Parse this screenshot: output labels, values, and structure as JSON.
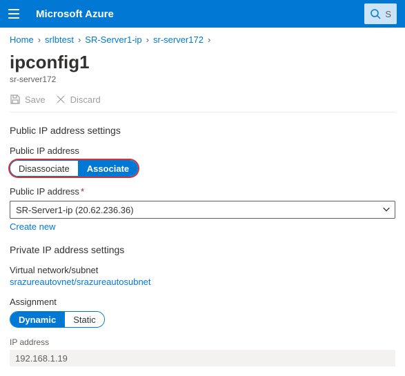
{
  "header": {
    "brand": "Microsoft Azure",
    "search_placeholder": "S"
  },
  "breadcrumb": {
    "items": [
      "Home",
      "srlbtest",
      "SR-Server1-ip",
      "sr-server172"
    ]
  },
  "page": {
    "title": "ipconfig1",
    "subtitle": "sr-server172"
  },
  "toolbar": {
    "save_label": "Save",
    "discard_label": "Discard"
  },
  "public_ip": {
    "section_title": "Public IP address settings",
    "toggle_label": "Public IP address",
    "disassociate_label": "Disassociate",
    "associate_label": "Associate",
    "select_label": "Public IP address",
    "select_value": "SR-Server1-ip (20.62.236.36)",
    "create_new_label": "Create new"
  },
  "private_ip": {
    "section_title": "Private IP address settings",
    "vnet_label": "Virtual network/subnet",
    "vnet_value": "srazureautovnet/srazureautosubnet",
    "assignment_label": "Assignment",
    "dynamic_label": "Dynamic",
    "static_label": "Static",
    "ip_label": "IP address",
    "ip_value": "192.168.1.19"
  }
}
